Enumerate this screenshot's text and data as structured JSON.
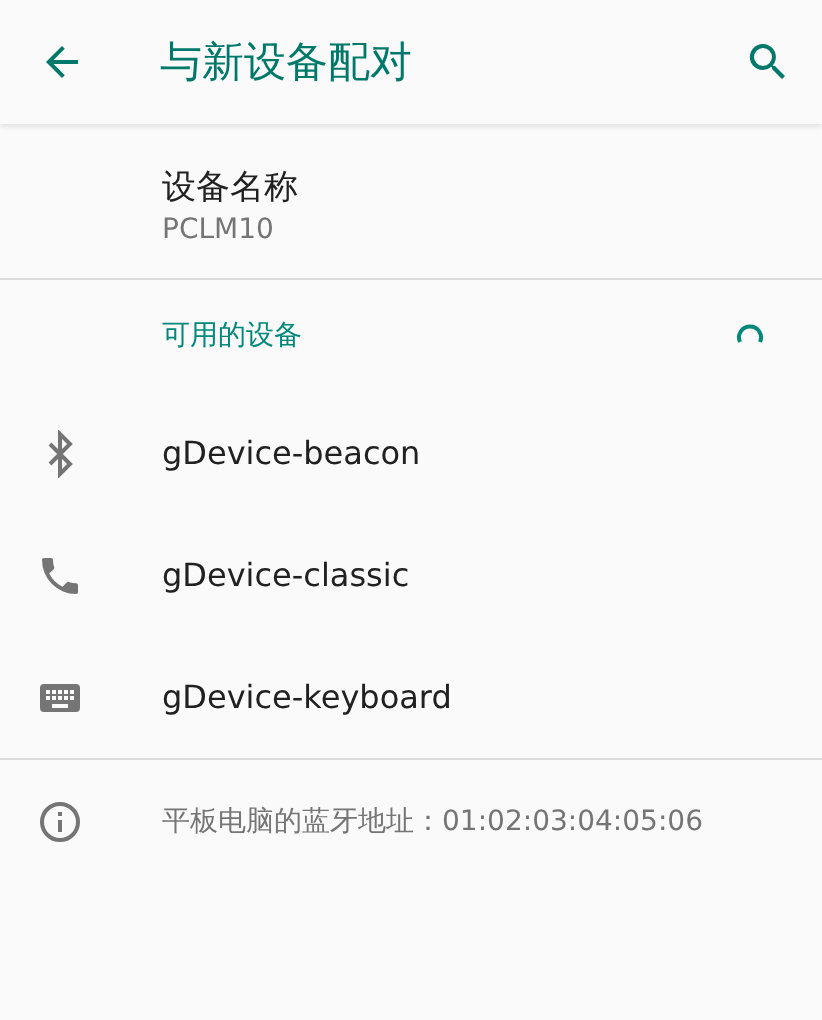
{
  "header": {
    "title": "与新设备配对"
  },
  "device_name": {
    "label": "设备名称",
    "value": "PCLM10"
  },
  "available": {
    "heading": "可用的设备",
    "scanning": true
  },
  "devices": [
    {
      "name": "gDevice-beacon",
      "kind": "bluetooth"
    },
    {
      "name": "gDevice-classic",
      "kind": "phone"
    },
    {
      "name": "gDevice-keyboard",
      "kind": "keyboard"
    }
  ],
  "footer": {
    "text": "平板电脑的蓝牙地址：01:02:03:04:05:06"
  }
}
